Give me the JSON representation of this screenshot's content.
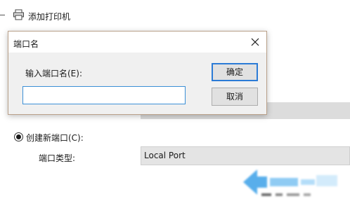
{
  "background": {
    "add_printer_label": "添加打印机",
    "create_port_label": "创建新端口(C):",
    "port_type_label": "端口类型:",
    "port_type_value": "Local Port"
  },
  "dialog": {
    "title": "端口名",
    "input_label": "输入端口名(E):",
    "input_value": "",
    "ok_label": "确定",
    "cancel_label": "取消"
  },
  "colors": {
    "accent_blue": "#2b7bd6",
    "dialog_border": "#b9a089",
    "watermark_blue": "#3aa0e8"
  }
}
